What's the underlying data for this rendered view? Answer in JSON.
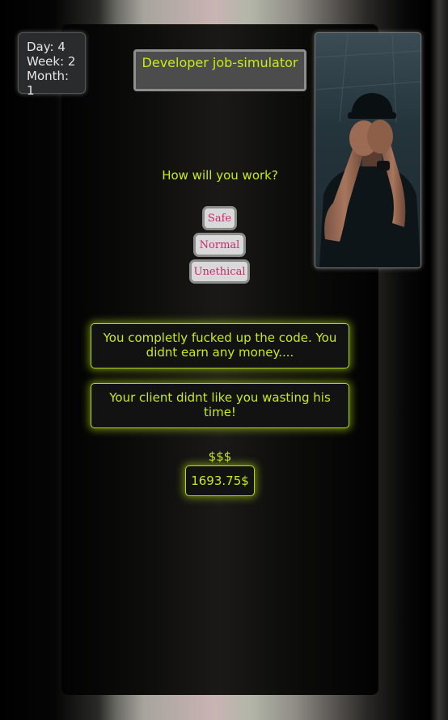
{
  "status": {
    "day_label": "Day: 4",
    "week_label": "Week: 2",
    "month_label": "Month: 1"
  },
  "title": "Developer job-simulator",
  "question": "How will you work?",
  "choices": {
    "safe": "Safe",
    "normal": "Normal",
    "unethical": "Unethical"
  },
  "messages": {
    "result": "You completly fucked up the code. You didnt earn any money....",
    "client": "Your client didnt like you wasting his time!"
  },
  "money": {
    "label": "$$$",
    "amount": "1693.75$"
  },
  "image": {
    "icon": "frustrated-developer-photo"
  },
  "colors": {
    "accent": "#c6ea1c",
    "button_text": "#c42a6c"
  }
}
